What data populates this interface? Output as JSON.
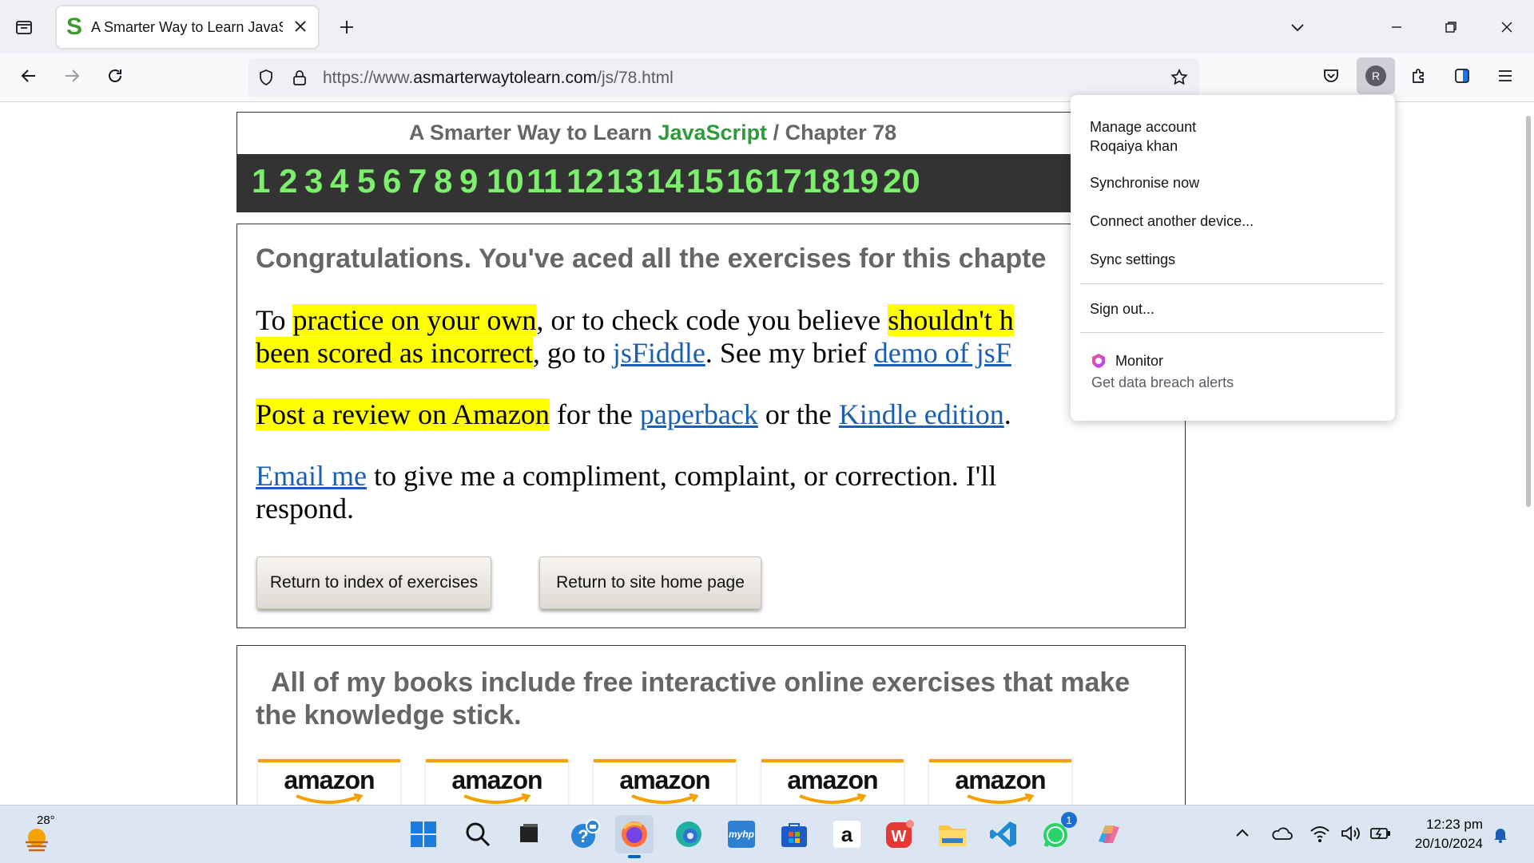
{
  "browser": {
    "tab_title": "A Smarter Way to Learn JavaScr",
    "favicon_letter": "S",
    "url_prefix": "https://www.",
    "url_domain": "asmarterwaytolearn.com",
    "url_path": "/js/78.html"
  },
  "header": {
    "title_part1": "A Smarter Way to Learn",
    "title_js": "JavaScript",
    "title_part2": "/ Chapter 78",
    "chapters": [
      "1",
      "2",
      "3",
      "4",
      "5",
      "6",
      "7",
      "8",
      "9",
      "10",
      "11",
      "12",
      "13",
      "14",
      "15",
      "16",
      "17",
      "18",
      "19",
      "20"
    ]
  },
  "main": {
    "heading": "Congratulations. You've aced all the exercises for this chapte",
    "p1_a": "To ",
    "p1_hl1": "practice on your own",
    "p1_b": ", or to check code you believe ",
    "p1_hl2": "shouldn't h",
    "p1_hl3": "been scored as incorrect",
    "p1_c": ", go to ",
    "p1_link1": "jsFiddle",
    "p1_d": ". See my brief ",
    "p1_link2": "demo of jsF",
    "p2_hl": "Post a review on Amazon",
    "p2_a": " for the ",
    "p2_link1": "paperback",
    "p2_b": " or the ",
    "p2_link2": "Kindle edition",
    "p2_c": ".",
    "p3_link": "Email me",
    "p3_a": " to give me a compliment, complaint, or correction. I'll",
    "p3_b": "respond.",
    "btn_index": "Return to index of exercises",
    "btn_home": "Return to site home page"
  },
  "books": {
    "heading_line1": "All of my books include free interactive online exercises that make",
    "heading_line2": "the knowledge stick.",
    "amazon_labels": [
      "amazon",
      "amazon",
      "amazon",
      "amazon",
      "amazon"
    ]
  },
  "account_menu": {
    "manage": "Manage account",
    "user": "Roqaiya khan",
    "sync_now": "Synchronise now",
    "connect": "Connect another device...",
    "sync_settings": "Sync settings",
    "sign_out": "Sign out...",
    "monitor": "Monitor",
    "monitor_sub": "Get data breach alerts"
  },
  "toolbar": {
    "avatar_letter": "R"
  },
  "taskbar": {
    "weather_temp": "28°",
    "time": "12:23 pm",
    "date": "20/10/2024",
    "whatsapp_badge": "1"
  },
  "colors": {
    "highlight": "#ffff00",
    "link": "#1a5fb4",
    "chapter_number": "#7cf06c",
    "js_green": "#2e9b3a"
  }
}
